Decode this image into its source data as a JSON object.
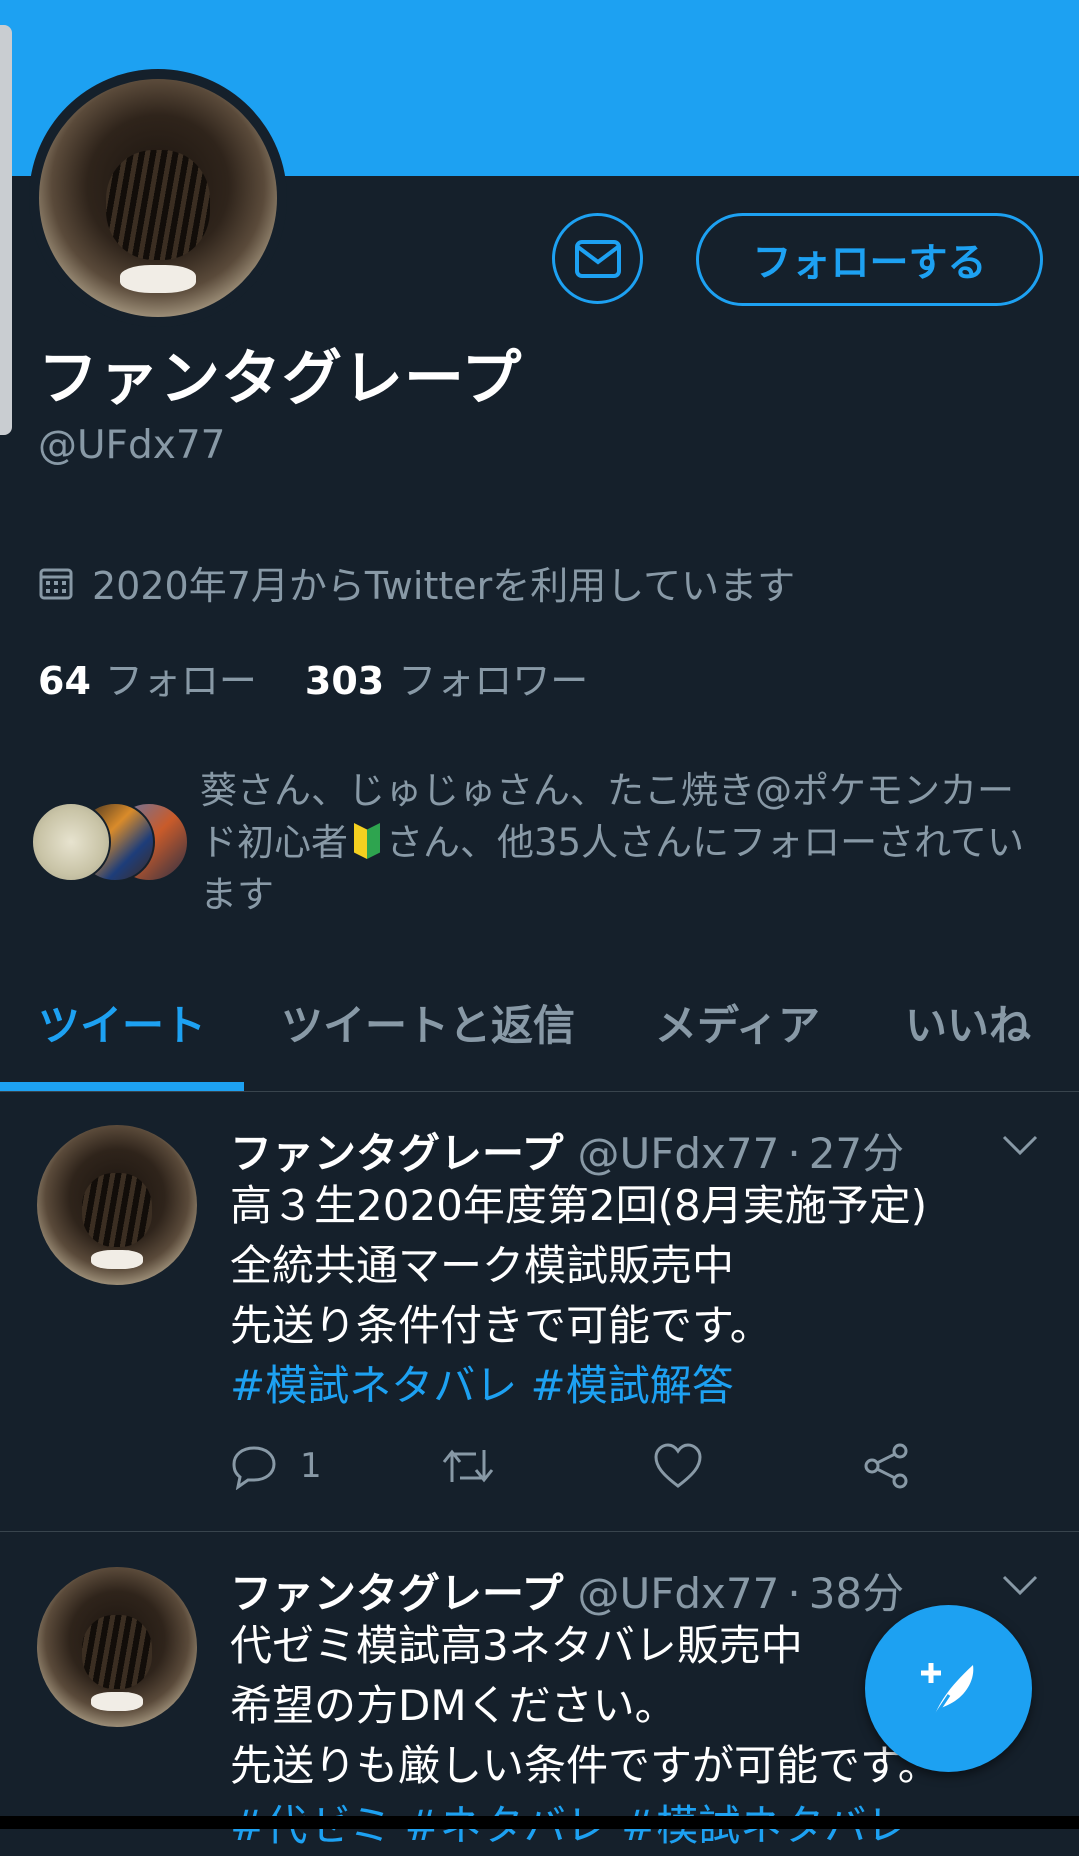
{
  "profile": {
    "display_name": "ファンタグレープ",
    "handle": "@UFdx77",
    "joined": "2020年7月からTwitterを利用しています",
    "follow_button_label": "フォローする",
    "following_count": "64",
    "following_label": "フォロー",
    "followers_count": "303",
    "followers_label": "フォロワー",
    "followed_by_part1": "葵さん、じゅじゅさん、たこ焼き@ポケモンカード初心者",
    "followed_by_part2": "さん、他35人さんにフォローされています"
  },
  "tabs": [
    {
      "label": "ツイート",
      "active": true
    },
    {
      "label": "ツイートと返信",
      "active": false
    },
    {
      "label": "メディア",
      "active": false
    },
    {
      "label": "いいね",
      "active": false
    }
  ],
  "tweets": [
    {
      "name": "ファンタグレープ",
      "handle": "@UFdx77",
      "time": "27分",
      "lines": [
        "高３生2020年度第2回(8月実施予定)",
        "全統共通マーク模試販売中",
        "先送り条件付きで可能です。"
      ],
      "hashtags": "#模試ネタバレ #模試解答",
      "reply_count": "1"
    },
    {
      "name": "ファンタグレープ",
      "handle": "@UFdx77",
      "time": "38分",
      "lines": [
        "代ゼミ模試高3ネタバレ販売中",
        "希望の方DMください。",
        "先送りも厳しい条件ですが可能です。"
      ],
      "hashtags": "#代ゼミ #ネタバレ #模試ネタバレ"
    }
  ],
  "colors": {
    "accent": "#1da1f2",
    "background": "#15202b",
    "secondary_text": "#8899a6",
    "divider": "#38444d"
  },
  "icons": [
    "mail-icon",
    "calendar-icon",
    "chevron-down-icon",
    "reply-icon",
    "retweet-icon",
    "like-icon",
    "share-icon",
    "compose-icon",
    "beginner-mark-icon"
  ]
}
